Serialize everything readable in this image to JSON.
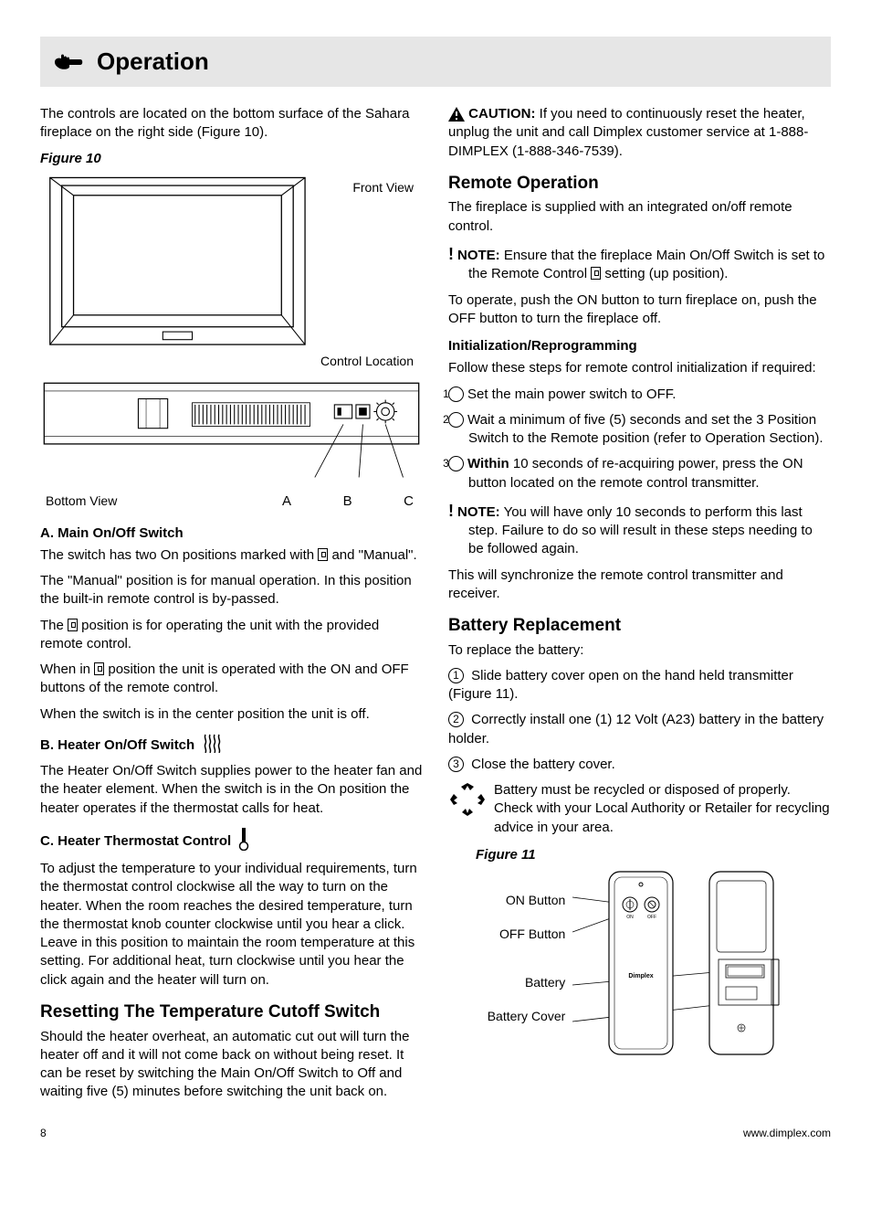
{
  "header": {
    "title": "Operation"
  },
  "left": {
    "intro": "The controls are located on the bottom surface of the Sahara fireplace on the right side (Figure 10).",
    "fig10_title": "Figure 10",
    "fig10_front": "Front View",
    "fig10_control": "Control Location",
    "fig10_bottom": "Bottom View",
    "fig10_A": "A",
    "fig10_B": "B",
    "fig10_C": "C",
    "a_head": "A. Main On/Off Switch",
    "a_p1a": "The switch has two On positions marked with ",
    "a_p1b": " and \"Manual\".",
    "a_p2": "The \"Manual\" position is for manual operation. In this position the built-in remote control is by-passed.",
    "a_p3a": "The ",
    "a_p3b": " position is for operating the unit with the provided remote control.",
    "a_p4a": "When in ",
    "a_p4b": " position the unit is operated with the ON and OFF buttons of the remote control.",
    "a_p5": "When the switch is in the center position the unit is off.",
    "b_head": "B. Heater On/Off Switch",
    "b_p1": "The Heater On/Off Switch supplies power to the heater fan and the heater element. When the switch is in the On position the heater operates if the thermostat calls for heat.",
    "c_head": "C. Heater Thermostat Control",
    "c_p1": "To adjust the temperature to your individual requirements, turn the thermostat control clockwise all the way to turn on the heater. When the room reaches the desired temperature, turn the thermostat knob counter clockwise until you hear a click. Leave in this position to maintain the room temperature at this setting. For additional heat, turn clockwise until you hear the click again and the heater will turn on.",
    "reset_head": "Resetting The Temperature Cutoff Switch",
    "reset_p1": "Should the heater overheat, an automatic cut out will turn the heater off and it will not come back on without being reset.  It can be reset by switching the Main On/Off Switch to Off and waiting five (5) minutes before switching the unit back on."
  },
  "right": {
    "caution_label": "CAUTION:",
    "caution_body": "  If you need to continuously reset the heater, unplug the unit and call Dimplex customer service at 1-888-DIMPLEX (1-888-346-7539).",
    "remote_head": "Remote Operation",
    "remote_p1": "The fireplace is supplied with an integrated on/off remote control.",
    "note_label": "NOTE:",
    "note1a": " Ensure that the fireplace Main On/Off Switch is set to the Remote Control ",
    "note1b": " setting (up position).",
    "remote_p2": "To operate, push the ON button to turn fireplace on, push the OFF button to turn the fireplace off.",
    "init_head": "Initialization/Reprogramming",
    "init_p1": "Follow these steps for remote control initialization if required:",
    "step1": "Set the main power switch to OFF.",
    "step2": "Wait a minimum of five (5) seconds and set the 3 Position Switch to the Remote position (refer to Operation Section).",
    "step3_bold": "Within",
    "step3_rest": " 10 seconds of re-acquiring power, press the ON button located on the remote control transmitter.",
    "note2": " You will have only 10 seconds to perform this last step.  Failure to do so will result in these steps needing to be followed again.",
    "init_p2": "This will synchronize the remote control transmitter and receiver.",
    "batt_head": "Battery Replacement",
    "batt_p1": "To replace the battery:",
    "bstep1": "  Slide battery cover open on the hand held transmitter (Figure 11).",
    "bstep2": "  Correctly install one (1) 12 Volt (A23) battery in the battery holder.",
    "bstep3": "  Close the battery cover.",
    "recycle": "Battery must be recycled or disposed of properly. Check with your Local Authority or Retailer for recycling advice in your area.",
    "fig11_title": "Figure 11",
    "fig11_on": "ON Button",
    "fig11_off": "OFF Button",
    "fig11_batt": "Battery",
    "fig11_cover": "Battery Cover",
    "fig11_brand_on": "ON",
    "fig11_brand_off": "OFF"
  },
  "footer": {
    "page": "8",
    "url": "www.dimplex.com"
  }
}
